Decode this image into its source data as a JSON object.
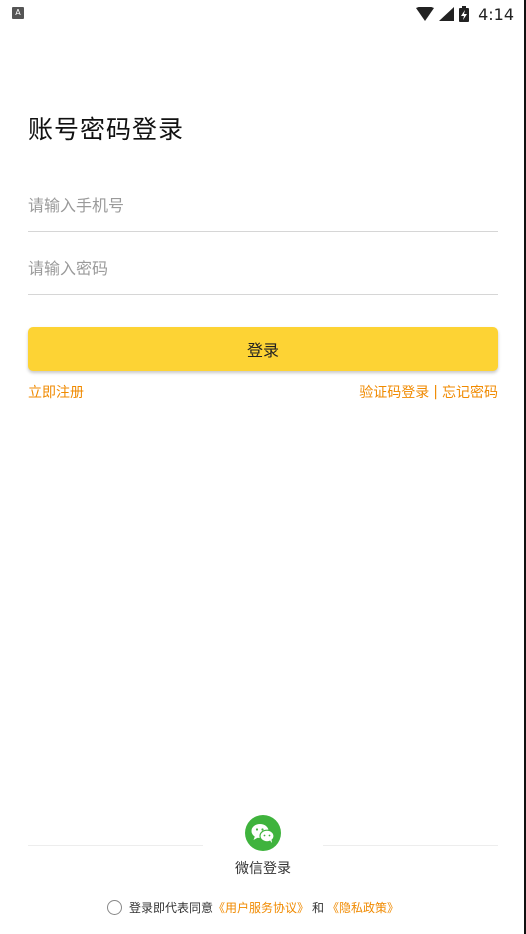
{
  "status_bar": {
    "notification_icon": "A",
    "time": "4:14",
    "icons": [
      "wifi-icon",
      "signal-icon",
      "battery-charging-icon"
    ]
  },
  "title": "账号密码登录",
  "phone_input": {
    "placeholder": "请输入手机号",
    "value": ""
  },
  "password_input": {
    "placeholder": "请输入密码",
    "value": ""
  },
  "login_button": "登录",
  "links": {
    "register": "立即注册",
    "sms_login": "验证码登录",
    "separator": "|",
    "forgot_password": "忘记密码"
  },
  "wechat": {
    "label": "微信登录",
    "icon": "wechat-icon"
  },
  "agreement": {
    "prefix": "登录即代表同意",
    "user_agreement": "《用户服务协议》",
    "and": "和",
    "privacy_policy": "《隐私政策》"
  },
  "colors": {
    "accent": "#fdd334",
    "link": "#f08a00",
    "wechat": "#3fb33d"
  }
}
